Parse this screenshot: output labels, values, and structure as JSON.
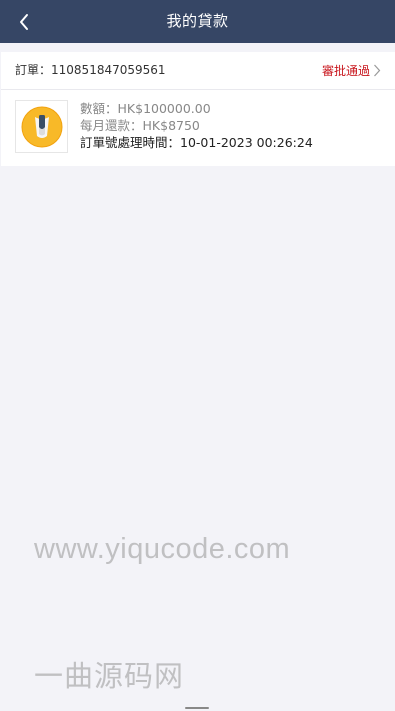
{
  "nav": {
    "title": "我的貸款",
    "back_icon": "chevron-left-icon"
  },
  "order": {
    "number_label": "訂單：",
    "number": "110851847059561",
    "status": "審批通過",
    "status_color": "#c8161d",
    "amount_label": "數額：",
    "amount": "HK$100000.00",
    "monthly_label": "每月還款：",
    "monthly": "HK$8750",
    "time_label": "訂單號處理時間：",
    "time": "10-01-2023 00:26:24"
  },
  "colors": {
    "navbar": "#364665",
    "background": "#f3f3f8",
    "card": "#ffffff"
  },
  "watermark": {
    "url": "www.yiqucode.com",
    "cn": "一曲源码网"
  }
}
